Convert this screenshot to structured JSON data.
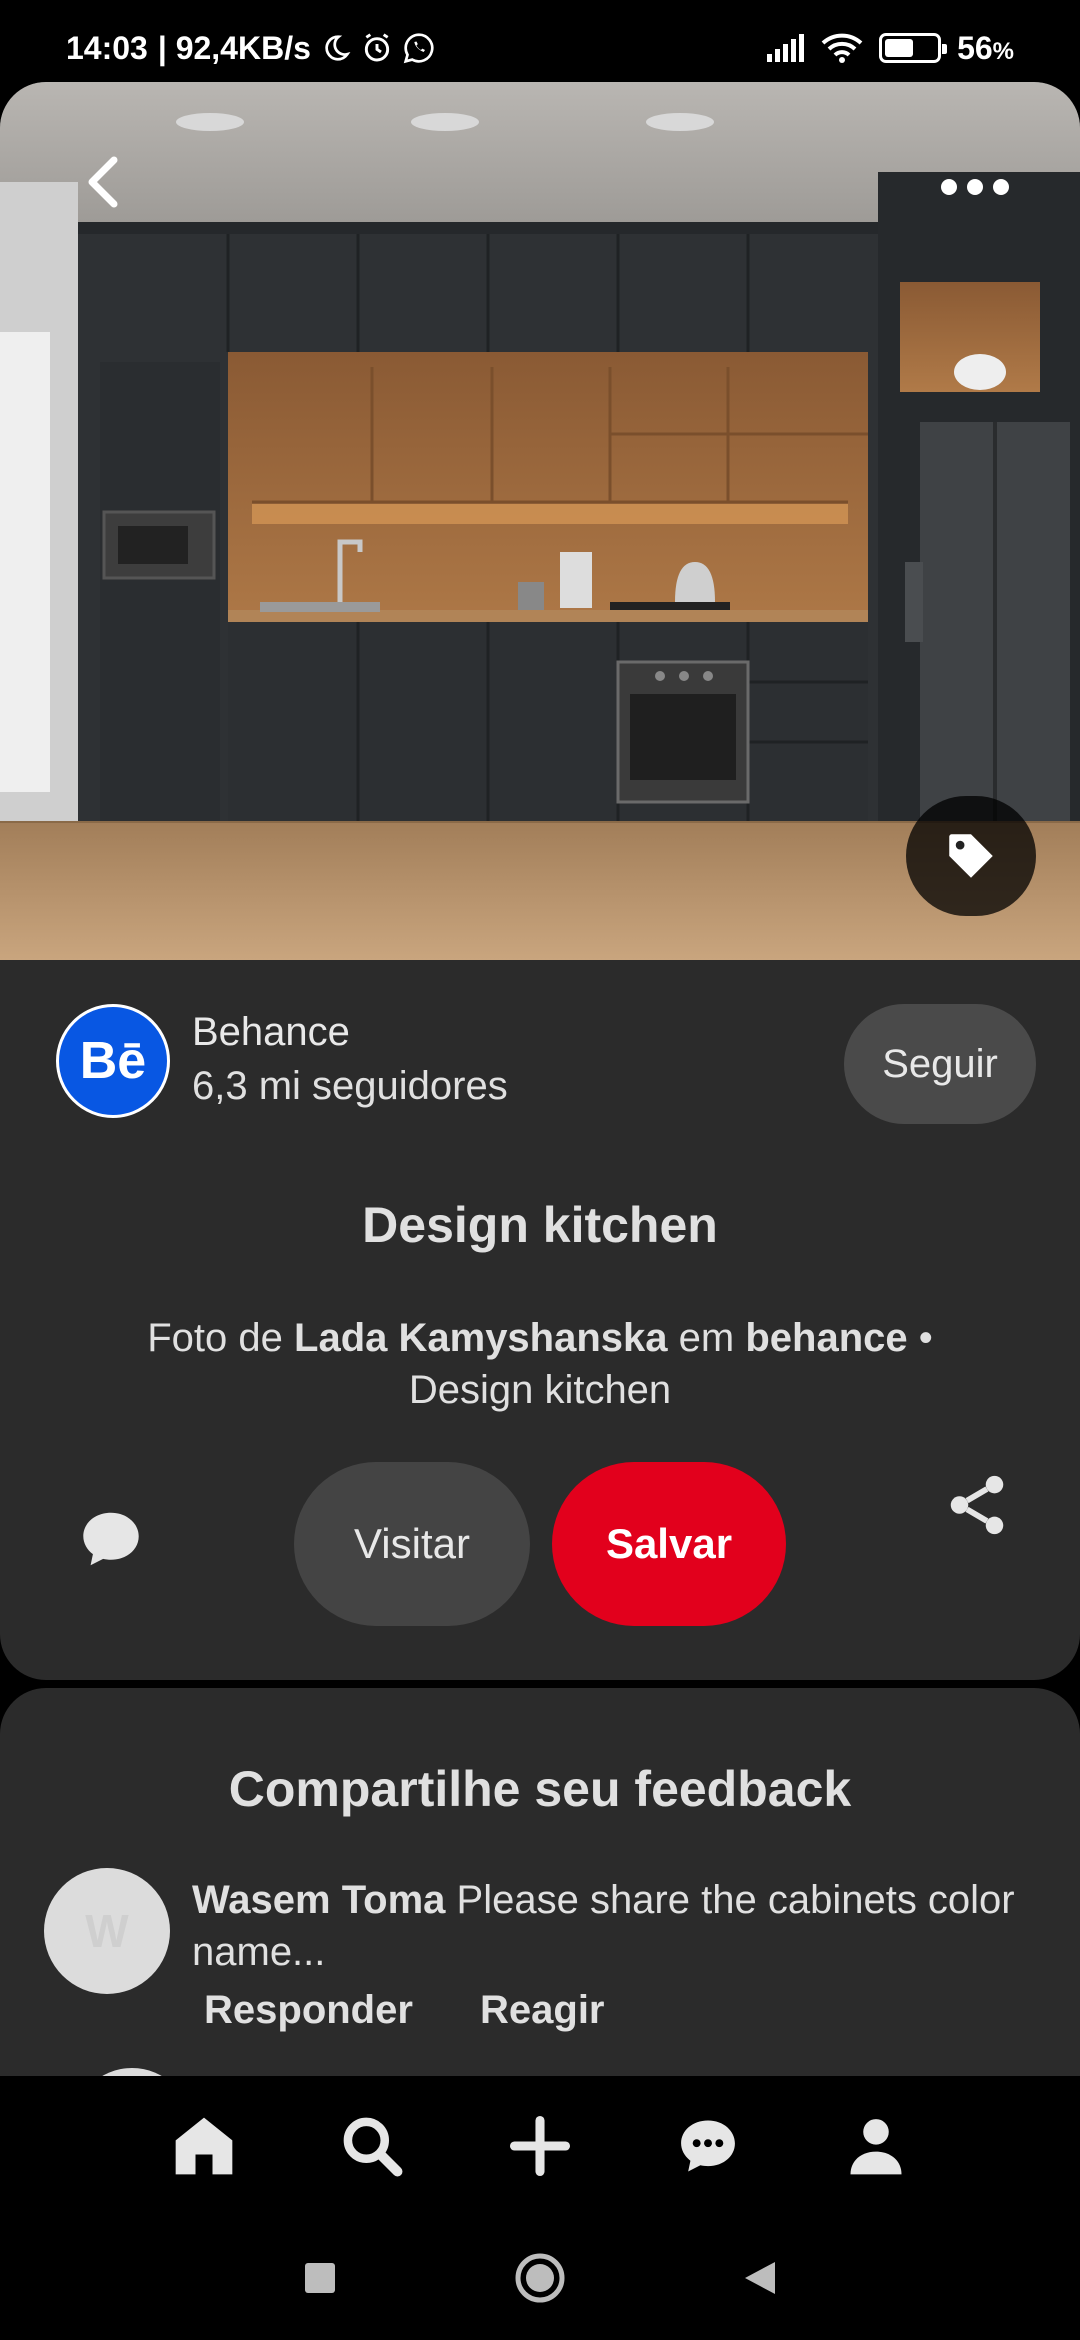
{
  "status_bar": {
    "time": "14:03",
    "network_speed": "| 92,4KB/s",
    "battery": "56",
    "battery_unit": "%",
    "battery_level": 0.56,
    "icons": [
      "moon-icon",
      "alarm-icon",
      "whatsapp-icon",
      "signal-icon",
      "wifi-icon",
      "battery-icon"
    ]
  },
  "pin": {
    "creator": {
      "avatar_text": "Bē",
      "name": "Behance",
      "followers": "6,3 mi seguidores",
      "follow_label": "Seguir"
    },
    "title": "Design kitchen",
    "description": {
      "prefix": "Foto de ",
      "author": "Lada Kamyshanska",
      "middle": " em ",
      "source": "behance",
      "suffix": " •",
      "line2": "Design kitchen"
    },
    "visit_label": "Visitar",
    "save_label": "Salvar"
  },
  "feedback": {
    "title": "Compartilhe seu feedback",
    "comments": [
      {
        "avatar_initial": "W",
        "author": "Wasem Toma",
        "text": " Please share the cabinets color name...",
        "reply_label": "Responder",
        "react_label": "Reagir"
      }
    ]
  },
  "colors": {
    "save": "#e2001c",
    "behance_blue": "#0857e3",
    "card_bg": "#2b2b2b"
  }
}
